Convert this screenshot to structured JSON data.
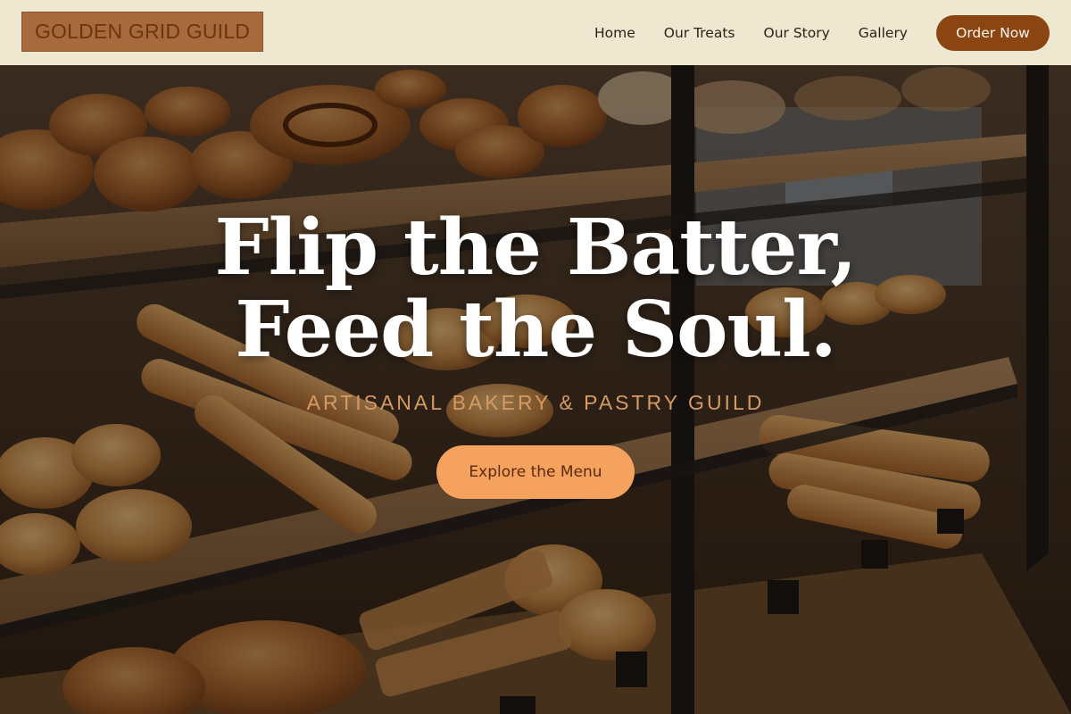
{
  "header": {
    "logo_text": "GOLDEN GRID GUILD",
    "nav": [
      {
        "label": "Home"
      },
      {
        "label": "Our Treats"
      },
      {
        "label": "Our Story"
      },
      {
        "label": "Gallery"
      }
    ],
    "order_button": "Order Now"
  },
  "hero": {
    "headline_line1": "Flip the Batter,",
    "headline_line2": "Feed the Soul.",
    "tagline": "ARTISANAL BAKERY & PASTRY GUILD",
    "cta_label": "Explore the Menu"
  },
  "colors": {
    "header_bg": "#fcf6de",
    "logo_bg": "#a66a3c",
    "brand_brown": "#8a4513",
    "cta_orange": "#f4a25d",
    "tagline_color": "#d79a62"
  }
}
